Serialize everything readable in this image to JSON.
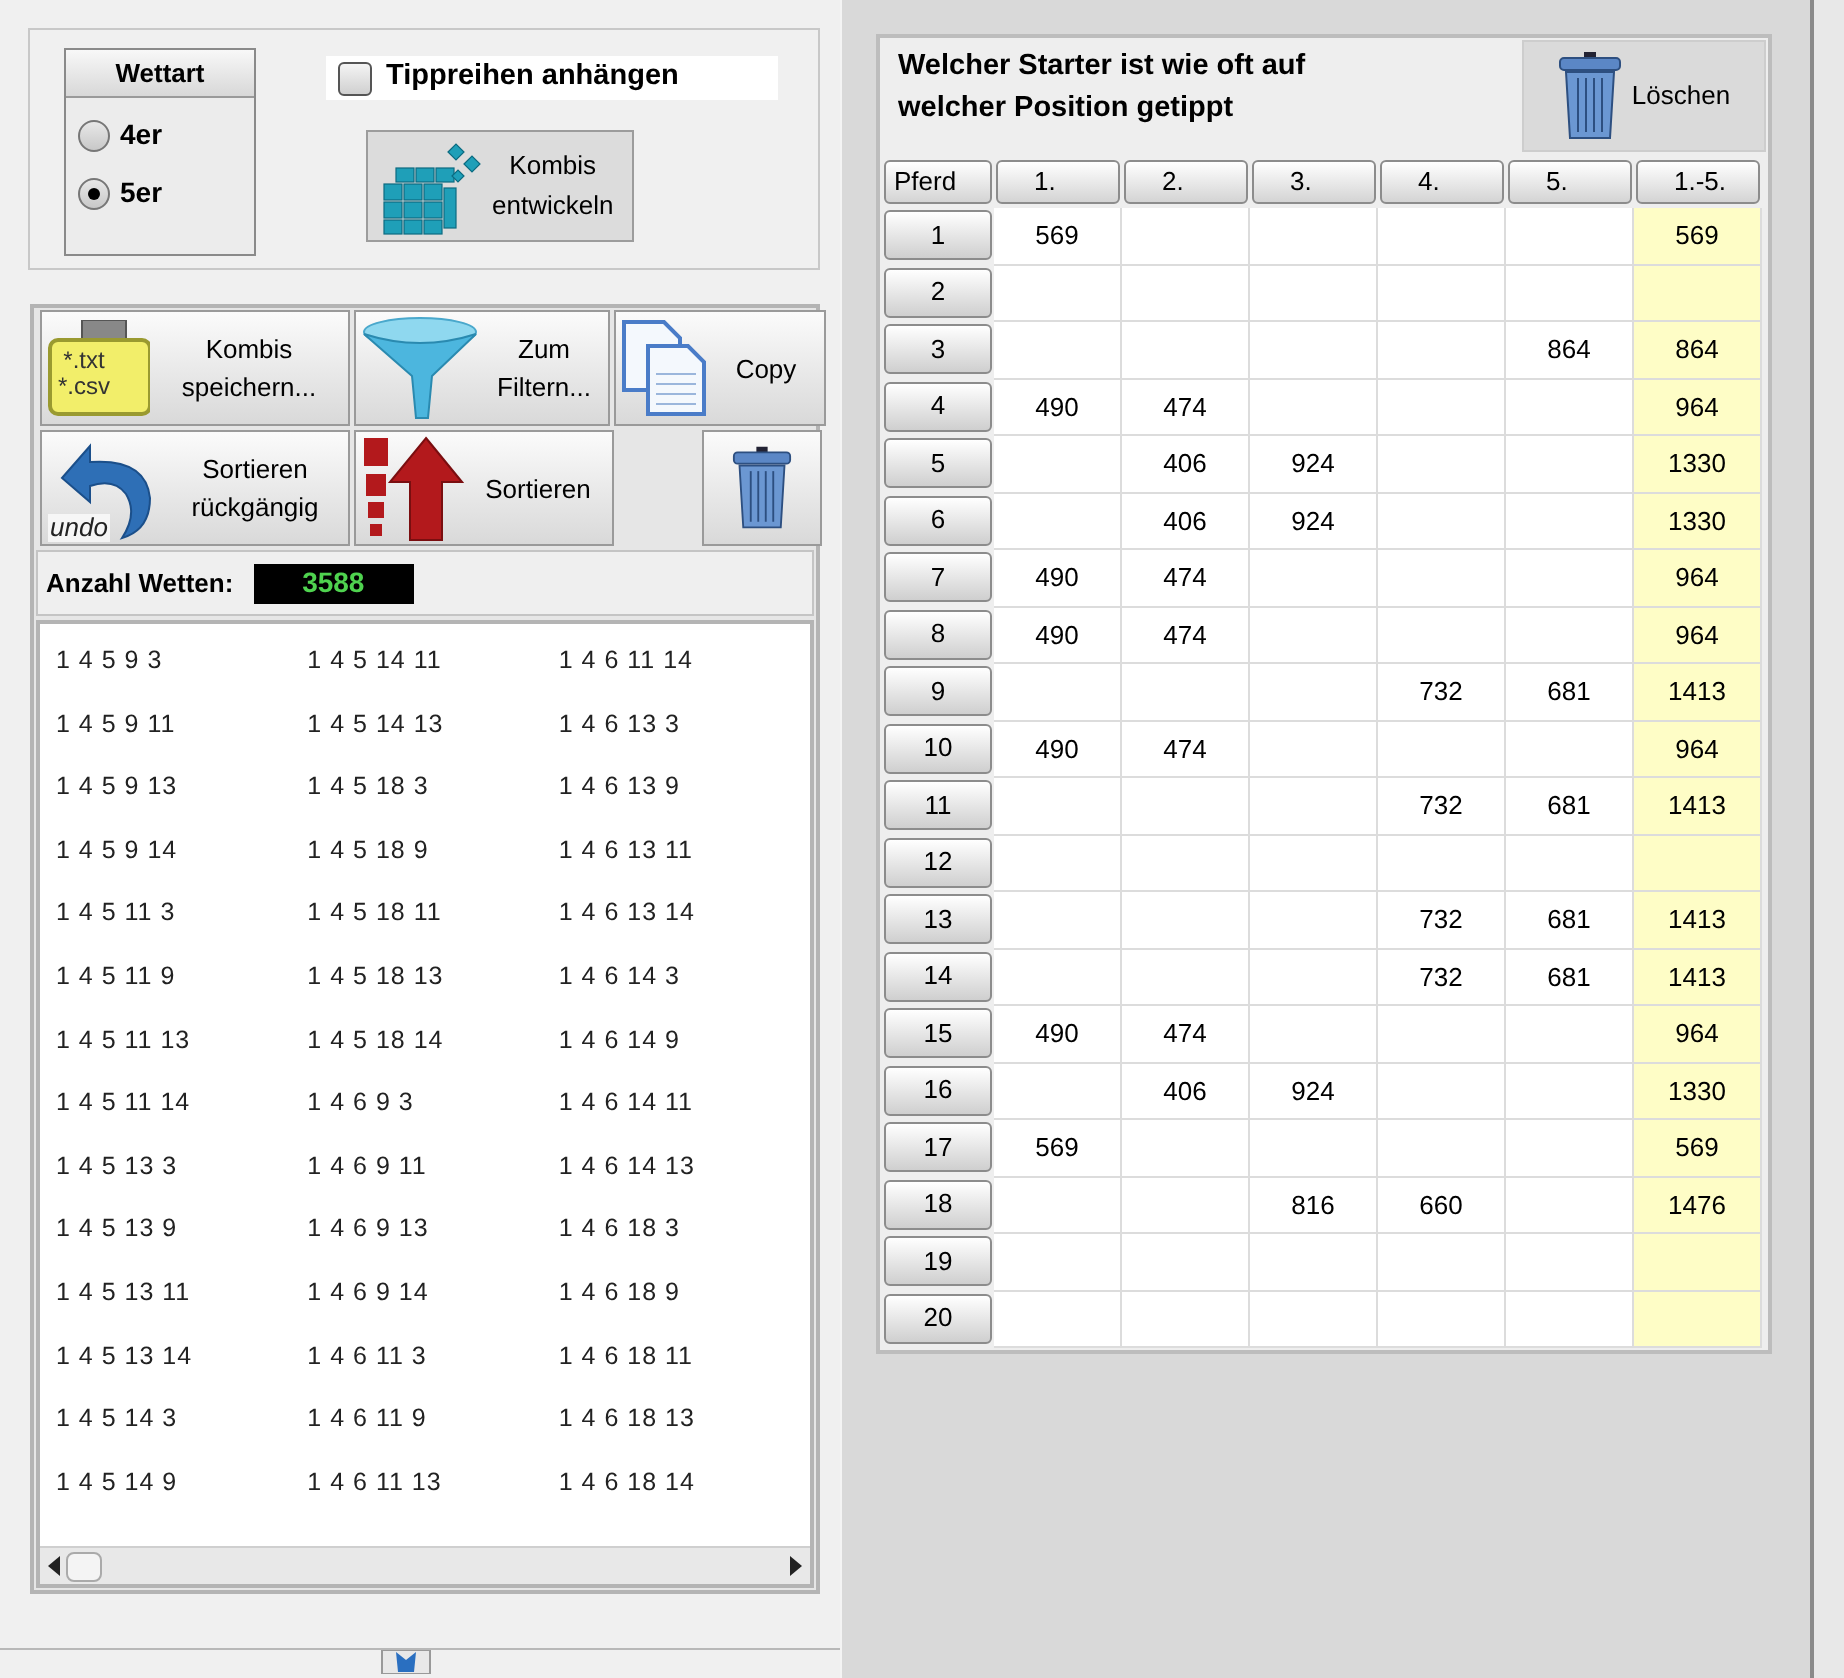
{
  "bet_type": {
    "title": "Wettart",
    "options": [
      {
        "label": "4er",
        "selected": false
      },
      {
        "label": "5er",
        "selected": true
      }
    ]
  },
  "append_checkbox": {
    "label": "Tippreihen anhängen",
    "checked": false
  },
  "develop_button": {
    "label_lines": [
      "Kombis",
      "entwickeln"
    ]
  },
  "toolbar": [
    {
      "kind": "save",
      "label_lines": [
        "Kombis",
        "speichern..."
      ],
      "icon_lines": [
        "*.txt",
        "*.csv"
      ]
    },
    {
      "kind": "filter",
      "label_lines": [
        "Zum",
        "Filtern..."
      ]
    },
    {
      "kind": "copy",
      "label_lines": [
        "Copy"
      ]
    },
    {
      "kind": "undo",
      "label_lines": [
        "Sortieren",
        "rückgängig"
      ],
      "icon_lines": [
        "undo"
      ]
    },
    {
      "kind": "sort",
      "label_lines": [
        "Sortieren"
      ]
    },
    {
      "kind": "delete"
    }
  ],
  "bet_count": {
    "label": "Anzahl Wetten:",
    "value": "3588"
  },
  "bet_columns": [
    [
      "1 4 5 9 3",
      "1 4 5 9 11",
      "1 4 5 9 13",
      "1 4 5 9 14",
      "1 4 5 11 3",
      "1 4 5 11 9",
      "1 4 5 11 13",
      "1 4 5 11 14",
      "1 4 5 13 3",
      "1 4 5 13 9",
      "1 4 5 13 11",
      "1 4 5 13 14",
      "1 4 5 14 3",
      "1 4 5 14 9"
    ],
    [
      "1 4 5 14 11",
      "1 4 5 14 13",
      "1 4 5 18 3",
      "1 4 5 18 9",
      "1 4 5 18 11",
      "1 4 5 18 13",
      "1 4 5 18 14",
      "1 4 6 9 3",
      "1 4 6 9 11",
      "1 4 6 9 13",
      "1 4 6 9 14",
      "1 4 6 11 3",
      "1 4 6 11 9",
      "1 4 6 11 13"
    ],
    [
      "1 4 6 11 14",
      "1 4 6 13 3",
      "1 4 6 13 9",
      "1 4 6 13 11",
      "1 4 6 13 14",
      "1 4 6 14 3",
      "1 4 6 14 9",
      "1 4 6 14 11",
      "1 4 6 14 13",
      "1 4 6 18 3",
      "1 4 6 18 9",
      "1 4 6 18 11",
      "1 4 6 18 13",
      "1 4 6 18 14"
    ]
  ],
  "stats": {
    "title_lines": [
      "Welcher Starter ist wie oft auf",
      "welcher Position getippt"
    ],
    "delete_button": "Löschen",
    "columns": [
      "Pferd",
      "1.",
      "2.",
      "3.",
      "4.",
      "5.",
      "1.-5."
    ],
    "rows": [
      {
        "horse": "1",
        "p1": "569",
        "total": "569"
      },
      {
        "horse": "2"
      },
      {
        "horse": "3",
        "p5": "864",
        "total": "864"
      },
      {
        "horse": "4",
        "p1": "490",
        "p2": "474",
        "total": "964"
      },
      {
        "horse": "5",
        "p2": "406",
        "p3": "924",
        "total": "1330"
      },
      {
        "horse": "6",
        "p2": "406",
        "p3": "924",
        "total": "1330"
      },
      {
        "horse": "7",
        "p1": "490",
        "p2": "474",
        "total": "964"
      },
      {
        "horse": "8",
        "p1": "490",
        "p2": "474",
        "total": "964"
      },
      {
        "horse": "9",
        "p4": "732",
        "p5": "681",
        "total": "1413"
      },
      {
        "horse": "10",
        "p1": "490",
        "p2": "474",
        "total": "964"
      },
      {
        "horse": "11",
        "p4": "732",
        "p5": "681",
        "total": "1413"
      },
      {
        "horse": "12"
      },
      {
        "horse": "13",
        "p4": "732",
        "p5": "681",
        "total": "1413"
      },
      {
        "horse": "14",
        "p4": "732",
        "p5": "681",
        "total": "1413"
      },
      {
        "horse": "15",
        "p1": "490",
        "p2": "474",
        "total": "964"
      },
      {
        "horse": "16",
        "p2": "406",
        "p3": "924",
        "total": "1330"
      },
      {
        "horse": "17",
        "p1": "569",
        "total": "569"
      },
      {
        "horse": "18",
        "p3": "816",
        "p4": "660",
        "total": "1476"
      },
      {
        "horse": "19"
      },
      {
        "horse": "20"
      }
    ]
  }
}
